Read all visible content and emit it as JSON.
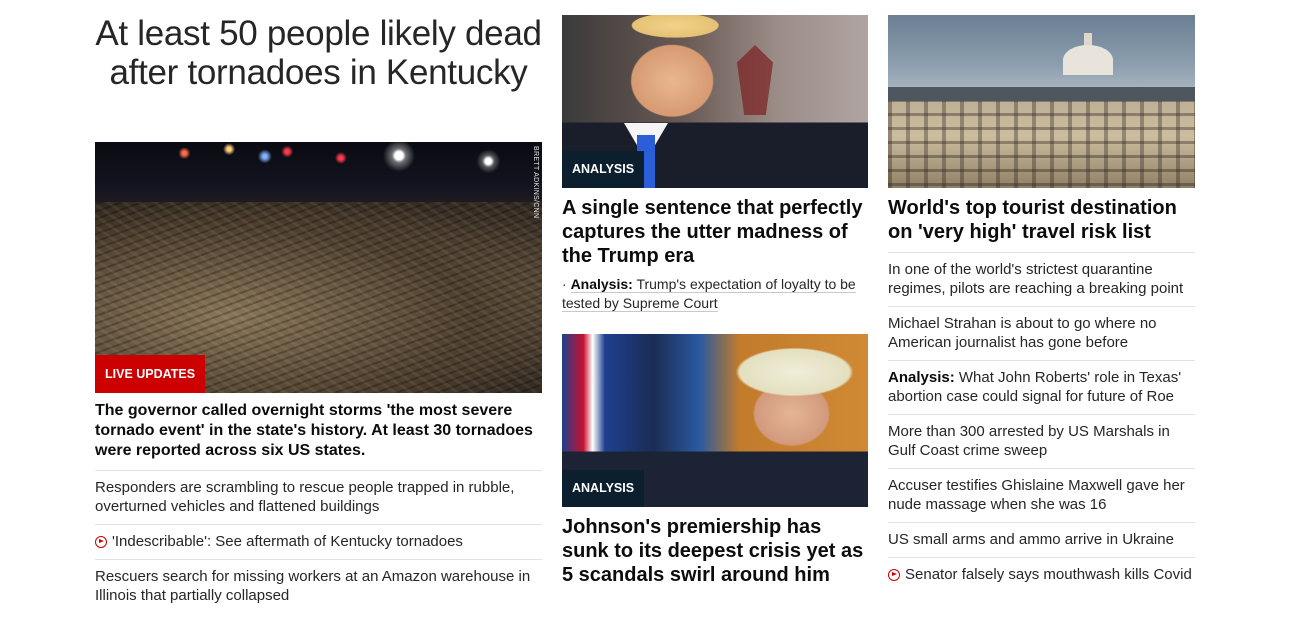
{
  "lead": {
    "headline": "At least 50 people likely dead after tornadoes in Kentucky",
    "image_credit": "BRETT ADKINS/CNN",
    "badge": "LIVE UPDATES",
    "summary": "The governor called overnight storms 'the most severe tornado event' in the state's history. At least 30 tornadoes were reported across six US states.",
    "links": [
      {
        "text": "Responders are scrambling to rescue people trapped in rubble, overturned vehicles and flattened buildings",
        "video": false
      },
      {
        "text": "'Indescribable': See aftermath of Kentucky tornadoes",
        "video": true
      },
      {
        "text": "Rescuers search for missing workers at an Amazon warehouse in Illinois that partially collapsed",
        "video": false
      }
    ]
  },
  "middle": {
    "card1": {
      "badge": "ANALYSIS",
      "headline": "A single sentence that perfectly captures the utter madness of the Trump era",
      "sub_prefix": "Analysis:",
      "sub_text": "Trump's expectation of loyalty to be tested by Supreme Court"
    },
    "card2": {
      "badge": "ANALYSIS",
      "headline": "Johnson's premiership has sunk to its deepest crisis yet as 5 scandals swirl around him"
    }
  },
  "right": {
    "headline": "World's top tourist destination on 'very high' travel risk list",
    "links": [
      {
        "prefix": "",
        "text": "In one of the world's strictest quarantine regimes, pilots are reaching a breaking point",
        "video": false
      },
      {
        "prefix": "",
        "text": "Michael Strahan is about to go where no American journalist has gone before",
        "video": false
      },
      {
        "prefix": "Analysis:",
        "text": "What John Roberts' role in Texas' abortion case could signal for future of Roe",
        "video": false
      },
      {
        "prefix": "",
        "text": "More than 300 arrested by US Marshals in Gulf Coast crime sweep",
        "video": false
      },
      {
        "prefix": "",
        "text": "Accuser testifies Ghislaine Maxwell gave her nude massage when she was 16",
        "video": false
      },
      {
        "prefix": "",
        "text": "US small arms and ammo arrive in Ukraine",
        "video": false
      },
      {
        "prefix": "",
        "text": "Senator falsely says mouthwash kills Covid",
        "video": true
      }
    ]
  },
  "colors": {
    "live_badge": "#cc0000",
    "analysis_badge": "#0c1f2e",
    "text": "#0c0c0c",
    "divider": "#e1e1e1"
  }
}
